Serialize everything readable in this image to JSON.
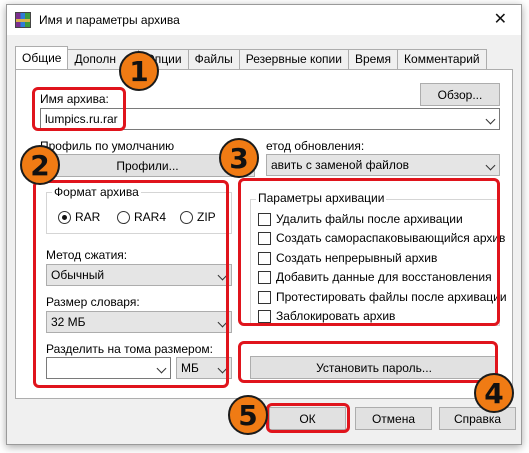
{
  "window": {
    "title": "Имя и параметры архива"
  },
  "tabs": [
    {
      "label": "Общие"
    },
    {
      "label": "Дополн"
    },
    {
      "label": "Опции"
    },
    {
      "label": "Файлы"
    },
    {
      "label": "Резервные копии"
    },
    {
      "label": "Время"
    },
    {
      "label": "Комментарий"
    }
  ],
  "general": {
    "browse_label": "Обзор...",
    "archive_name_label": "Имя архива:",
    "archive_name_value": "lumpics.ru.rar",
    "default_profile_label": "Профиль по умолчанию",
    "profiles_button": "Профили...",
    "update_method_label": "етод обновления:",
    "update_method_value": "авить с заменой файлов",
    "format": {
      "title": "Формат архива",
      "options": [
        {
          "label": "RAR",
          "selected": true
        },
        {
          "label": "RAR4",
          "selected": false
        },
        {
          "label": "ZIP",
          "selected": false
        }
      ]
    },
    "compression_label": "Метод сжатия:",
    "compression_value": "Обычный",
    "dict_label": "Размер словаря:",
    "dict_value": "32 МБ",
    "split_label": "Разделить на тома размером:",
    "split_value": "",
    "split_unit": "МБ",
    "options": {
      "title": "Параметры архивации",
      "items": [
        {
          "label": "Удалить файлы после архивации",
          "checked": false
        },
        {
          "label": "Создать самораспаковывающийся архив",
          "checked": false
        },
        {
          "label": "Создать непрерывный архив",
          "checked": false
        },
        {
          "label": "Добавить данные для восстановления",
          "checked": false
        },
        {
          "label": "Протестировать файлы после архивации",
          "checked": false
        },
        {
          "label": "Заблокировать архив",
          "checked": false
        }
      ]
    },
    "set_password_button": "Установить пароль..."
  },
  "footer": {
    "ok": "ОК",
    "cancel": "Отмена",
    "help": "Справка"
  },
  "annotations": [
    "1",
    "2",
    "3",
    "4",
    "5"
  ],
  "colors": {
    "highlight": "#e0141c",
    "badge": "#f07b14"
  }
}
